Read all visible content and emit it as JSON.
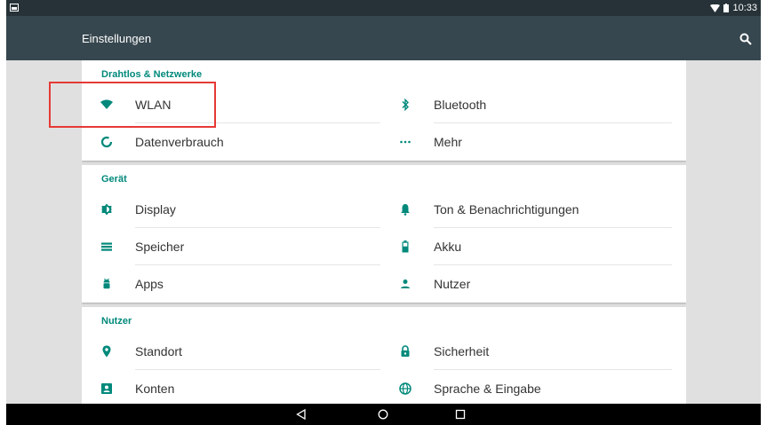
{
  "status_bar": {
    "time": "10:33",
    "icons": [
      "screenshot-icon",
      "wifi-icon",
      "battery-icon"
    ]
  },
  "toolbar": {
    "title": "Einstellungen",
    "search_icon": "search-icon"
  },
  "colors": {
    "toolbar": "#37474f",
    "status_bar": "#263238",
    "accent": "#00897b",
    "highlight": "#e53935"
  },
  "sections": [
    {
      "header": "Drahtlos & Netzwerke",
      "items": [
        {
          "label": "WLAN",
          "icon": "wifi-icon"
        },
        {
          "label": "Bluetooth",
          "icon": "bluetooth-icon"
        },
        {
          "label": "Datenverbrauch",
          "icon": "data-usage-icon"
        },
        {
          "label": "Mehr",
          "icon": "more-icon"
        }
      ]
    },
    {
      "header": "Gerät",
      "items": [
        {
          "label": "Display",
          "icon": "brightness-icon"
        },
        {
          "label": "Ton & Benachrichtigungen",
          "icon": "bell-icon"
        },
        {
          "label": "Speicher",
          "icon": "storage-icon"
        },
        {
          "label": "Akku",
          "icon": "battery-icon"
        },
        {
          "label": "Apps",
          "icon": "android-icon"
        },
        {
          "label": "Nutzer",
          "icon": "person-icon"
        }
      ]
    },
    {
      "header": "Nutzer",
      "items": [
        {
          "label": "Standort",
          "icon": "location-icon"
        },
        {
          "label": "Sicherheit",
          "icon": "lock-icon"
        },
        {
          "label": "Konten",
          "icon": "account-icon"
        },
        {
          "label": "Sprache & Eingabe",
          "icon": "globe-icon"
        }
      ]
    }
  ],
  "nav_bar": [
    "back-icon",
    "home-icon",
    "recents-icon"
  ]
}
